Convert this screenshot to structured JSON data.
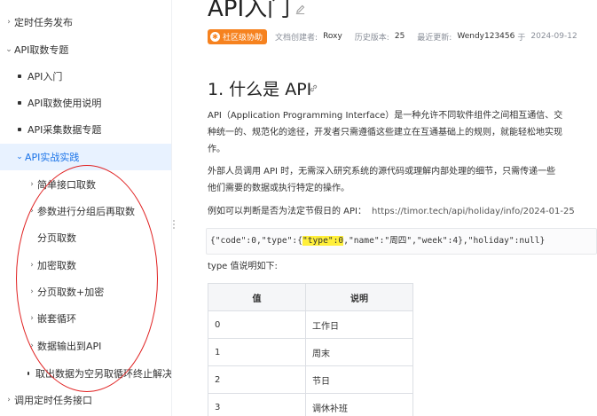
{
  "sidebar": {
    "items": [
      {
        "label": "定时任务发布",
        "marker": "caret-right"
      },
      {
        "label": "API取数专题",
        "marker": "caret-down"
      },
      {
        "label": "API入门",
        "marker": "dot"
      },
      {
        "label": "API取数使用说明",
        "marker": "dot"
      },
      {
        "label": "API采集数据专题",
        "marker": "dot"
      },
      {
        "label": "API实战实践",
        "marker": "caret-down",
        "active": true
      },
      {
        "label": "简单接口取数",
        "marker": "caret-right"
      },
      {
        "label": "参数进行分组后再取数",
        "marker": "caret-right"
      },
      {
        "label": "分页取数",
        "marker": "none"
      },
      {
        "label": "加密取数",
        "marker": "caret-right"
      },
      {
        "label": "分页取数+加密",
        "marker": "caret-right"
      },
      {
        "label": "嵌套循环",
        "marker": "caret-right"
      },
      {
        "label": "数据输出到API",
        "marker": "caret-right"
      },
      {
        "label": "取出数据为空另取循环终止解决",
        "marker": "dot"
      },
      {
        "label": "调用定时任务接口",
        "marker": "caret-right"
      }
    ]
  },
  "article": {
    "title": "API入门",
    "badge": "社区级协助",
    "creator_label": "文档创建者:",
    "creator": "Roxy",
    "version_label": "历史版本:",
    "version": "25",
    "updated_label": "最近更新:",
    "updated_by": "Wendy123456",
    "updated_on_label": "于",
    "updated_date": "2024-09-12",
    "section_heading": "1. 什么是 API",
    "para1_line1": "API（Application Programming Interface）是一种允许不同软件组件之间相互通信、交",
    "para1_line2": "种统一的、规范化的途径，开发者只需遵循这些建立在互通基础上的规则，就能轻松地实现",
    "para1_line3": "作。",
    "para2_line1": "外部人员调用 API 时，无需深入研究系统的源代码或理解内部处理的细节，只需传递一些",
    "para2_line2": "他们需要的数据或执行特定的操作。",
    "example_text": "例如可以判断是否为法定节假日的 API：",
    "example_url": "https://timor.tech/api/holiday/info/2024-01-25",
    "code_before": "{\"code\":0,\"type\":{",
    "code_highlight": "\"type\":0",
    "code_after": ",\"name\":\"周四\",\"week\":4},\"holiday\":null}",
    "type_desc": "type 值说明如下:",
    "table": {
      "headers": [
        "值",
        "说明"
      ],
      "rows": [
        [
          "0",
          "工作日"
        ],
        [
          "1",
          "周末"
        ],
        [
          "2",
          "节日"
        ],
        [
          "3",
          "调休补班"
        ]
      ]
    }
  },
  "colors": {
    "accent": "#1a73e8",
    "active_bg": "#e8f2ff",
    "badge": "#f6821f",
    "highlight": "#ffef3a",
    "annotation": "#e02020"
  }
}
